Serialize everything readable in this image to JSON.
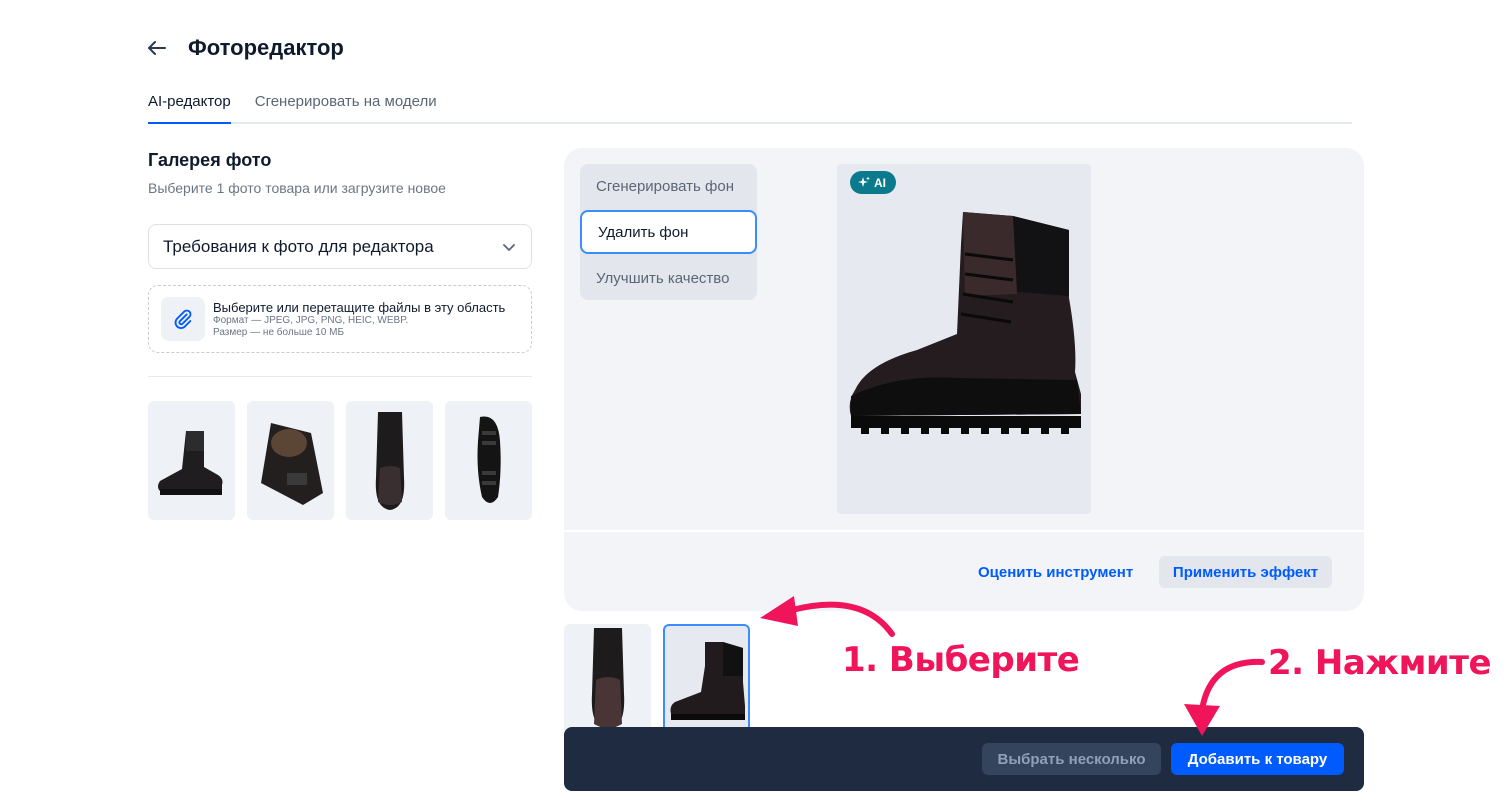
{
  "header": {
    "title": "Фоторедактор"
  },
  "tabs": [
    {
      "label": "AI-редактор"
    },
    {
      "label": "Сгенерировать на модели"
    }
  ],
  "gallery": {
    "title": "Галерея фото",
    "subtitle": "Выберите 1 фото товара или загрузите новое",
    "requirements_select": "Требования к фото для редактора",
    "upload": {
      "main": "Выберите или перетащите файлы в эту область",
      "format": "Формат — JPEG, JPG, PNG, HEIC, WEBP.",
      "size": "Размер — не больше 10 МБ"
    }
  },
  "tools": [
    {
      "label": "Сгенерировать фон"
    },
    {
      "label": "Удалить фон"
    },
    {
      "label": "Улучшить качество"
    }
  ],
  "preview": {
    "badge": "AI"
  },
  "panel_actions": {
    "rate": "Оценить инструмент",
    "apply": "Применить эффект"
  },
  "bottom_bar": {
    "multi": "Выбрать несколько",
    "add": "Добавить к товару"
  },
  "annotations": {
    "step1": "1. Выберите",
    "step2": "2. Нажмите"
  },
  "colors": {
    "accent": "#005bff",
    "annotation": "#f0145a",
    "bar": "#1e2b40"
  }
}
